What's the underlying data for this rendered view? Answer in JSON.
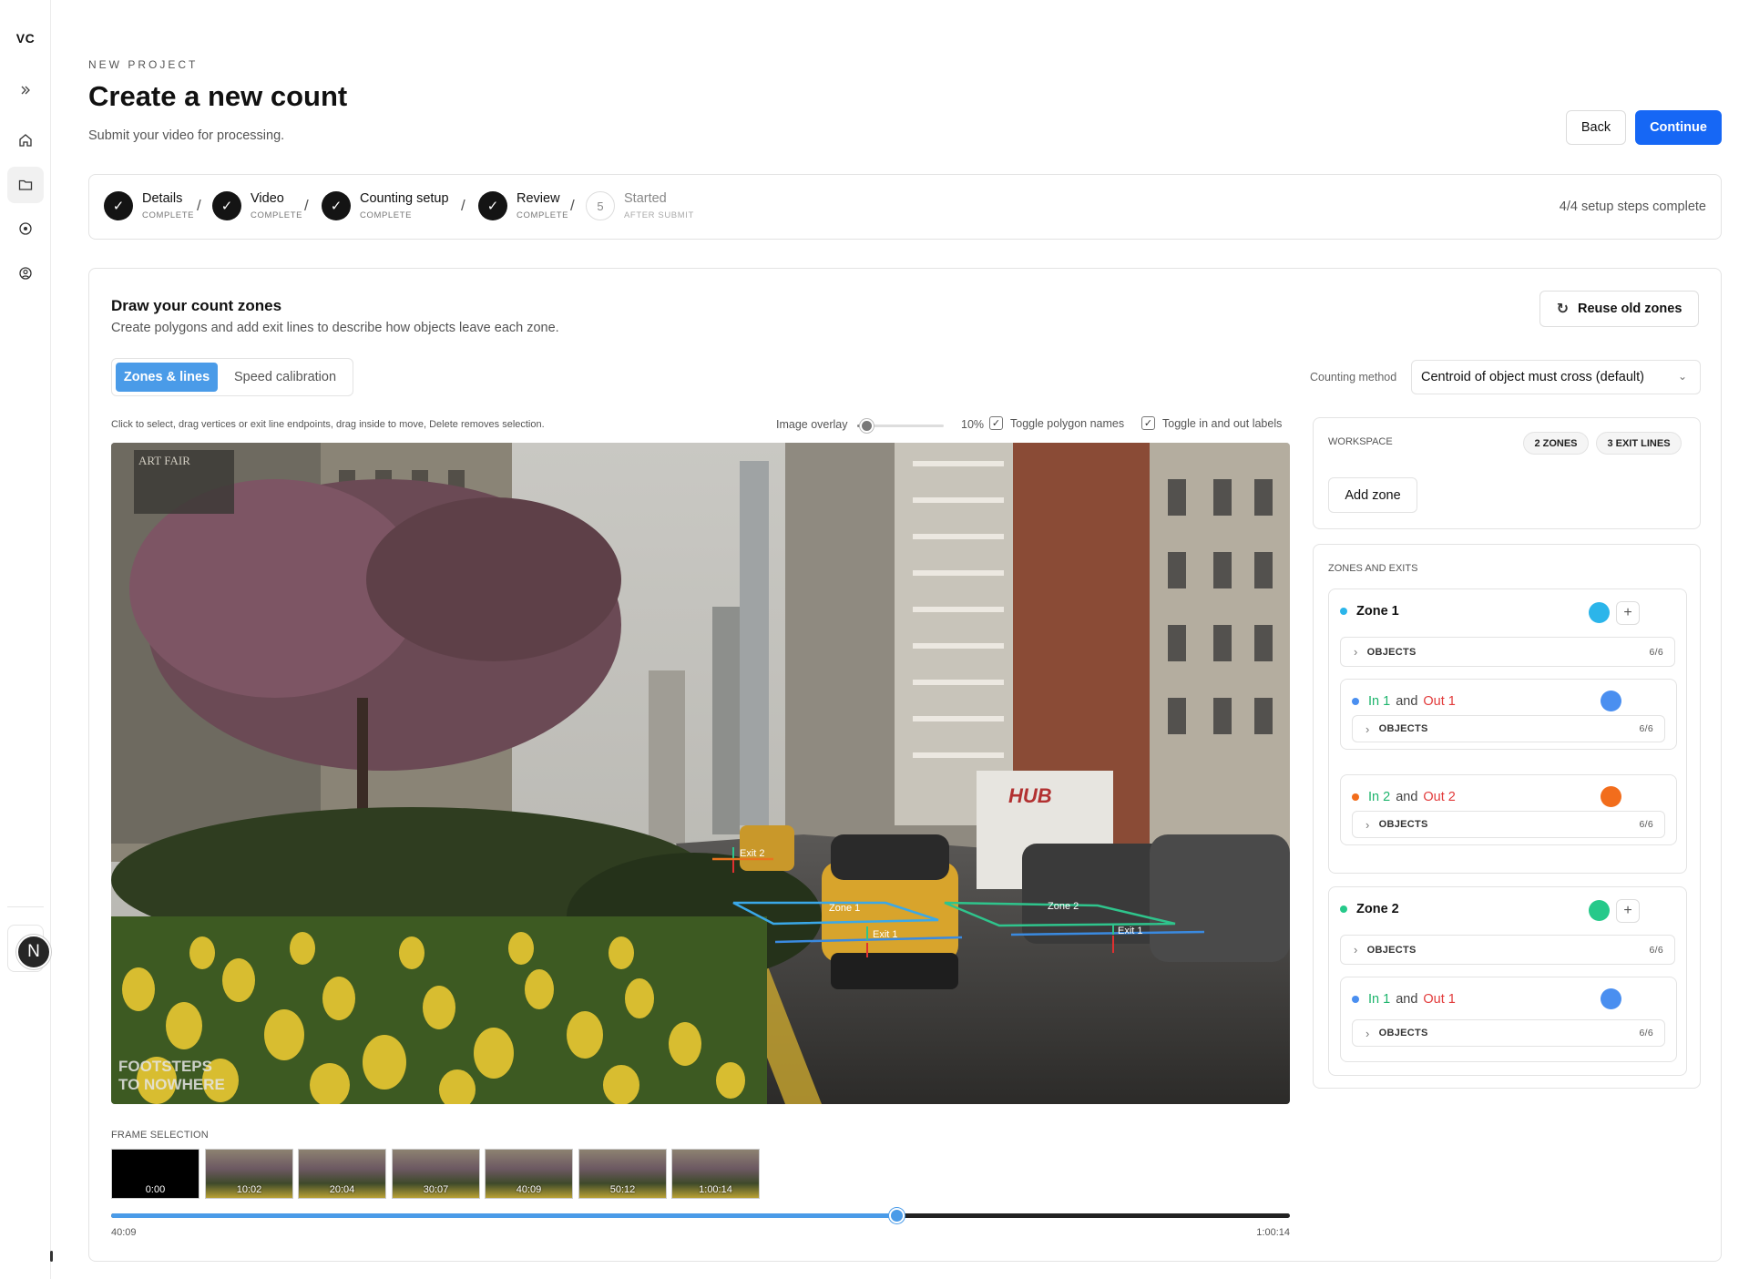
{
  "sidebar": {
    "logo": "VC",
    "avatar_initial": "N"
  },
  "header": {
    "eyebrow": "NEW PROJECT",
    "title": "Create a new count",
    "subtitle": "Submit your video for processing.",
    "back_label": "Back",
    "continue_label": "Continue"
  },
  "steps": {
    "items": [
      {
        "label": "Details",
        "status": "COMPLETE"
      },
      {
        "label": "Video",
        "status": "COMPLETE"
      },
      {
        "label": "Counting setup",
        "status": "COMPLETE"
      },
      {
        "label": "Review",
        "status": "COMPLETE"
      },
      {
        "number": "5",
        "label": "Started",
        "status": "AFTER SUBMIT"
      }
    ],
    "separator": "/",
    "summary": "4/4 setup steps complete"
  },
  "zones_panel": {
    "title": "Draw your count zones",
    "subtitle": "Create polygons and add exit lines to describe how objects leave each zone.",
    "reuse_label": "Reuse old zones",
    "tabs": [
      "Zones & lines",
      "Speed calibration"
    ],
    "counting_method_label": "Counting method",
    "counting_method_value": "Centroid of object must cross (default)",
    "hint": "Click to select, drag vertices or exit line endpoints, drag inside to move, Delete removes selection.",
    "image_overlay_label": "Image overlay",
    "image_overlay_value": "10%",
    "image_overlay_fraction": 0.1,
    "toggle_polygon_names": "Toggle polygon names",
    "toggle_in_out_labels": "Toggle in and out labels"
  },
  "video": {
    "watermark_line1": "FOOTSTEPS",
    "watermark_line2": "TO NOWHERE",
    "banner_text": "ART FAIR",
    "truck_text": "HUB",
    "overlay_labels": {
      "zone1": "Zone 1",
      "zone2": "Zone 2",
      "exit1a": "Exit 1",
      "exit1b": "Exit 1",
      "exit2": "Exit 2"
    }
  },
  "frames": {
    "label": "FRAME SELECTION",
    "times": [
      "0:00",
      "10:02",
      "20:04",
      "30:07",
      "40:09",
      "50:12",
      "1:00:14"
    ],
    "current": "40:09",
    "end": "1:00:14",
    "progress_fraction": 0.666
  },
  "workspace": {
    "label": "WORKSPACE",
    "zones_pill": "2 ZONES",
    "lines_pill": "3 EXIT LINES",
    "add_zone_label": "Add zone"
  },
  "zones_exits": {
    "label": "ZONES AND EXITS",
    "objects_label": "OBJECTS",
    "objects_count": "6/6",
    "and_word": "and",
    "zones": [
      {
        "name": "Zone 1",
        "color": "#2bb5ea",
        "pairs": [
          {
            "in": "In 1",
            "out": "Out 1",
            "color": "#4a8ff0"
          },
          {
            "in": "In 2",
            "out": "Out 2",
            "color": "#f26d1c"
          }
        ]
      },
      {
        "name": "Zone 2",
        "color": "#26c98a",
        "pairs": [
          {
            "in": "In 1",
            "out": "Out 1",
            "color": "#4a8ff0"
          }
        ]
      }
    ]
  },
  "colors": {
    "accent": "#1667f5",
    "tab_active": "#4a9be8"
  }
}
